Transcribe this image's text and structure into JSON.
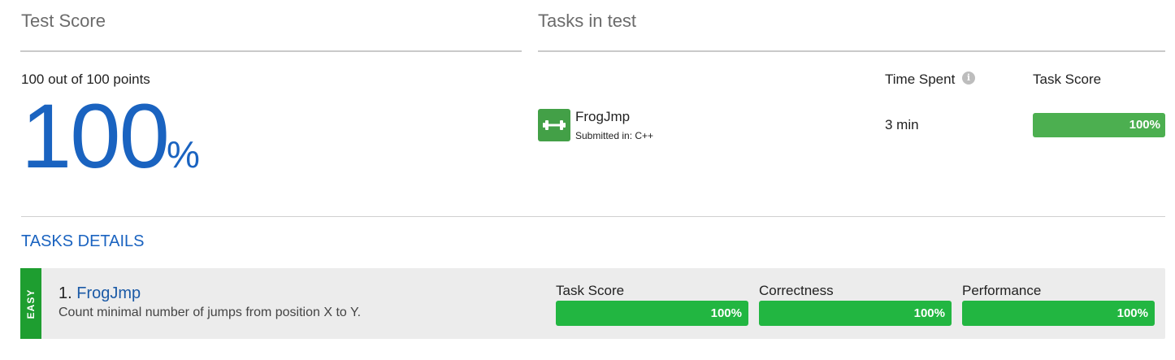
{
  "test_score": {
    "title": "Test Score",
    "points_text": "100 out of 100 points",
    "percent_value": "100",
    "percent_sign": "%"
  },
  "tasks_in_test": {
    "title": "Tasks in test",
    "time_spent_label": "Time Spent",
    "task_score_label": "Task Score",
    "info_icon": "i",
    "tasks": [
      {
        "name": "FrogJmp",
        "submitted": "Submitted in: C++",
        "time_spent": "3 min",
        "score_text": "100%",
        "score_fraction": 1.0
      }
    ]
  },
  "tasks_details": {
    "title": "TASKS DETAILS",
    "items": [
      {
        "difficulty": "EASY",
        "number": "1.",
        "name": "FrogJmp",
        "description": "Count minimal number of jumps from position X to Y.",
        "metrics": [
          {
            "label": "Task Score",
            "value": "100%"
          },
          {
            "label": "Correctness",
            "value": "100%"
          },
          {
            "label": "Performance",
            "value": "100%"
          }
        ]
      }
    ]
  },
  "colors": {
    "accent_blue": "#1a63c0",
    "success_green": "#22b641",
    "badge_green": "#43a047",
    "easy_green": "#1e9e30"
  }
}
